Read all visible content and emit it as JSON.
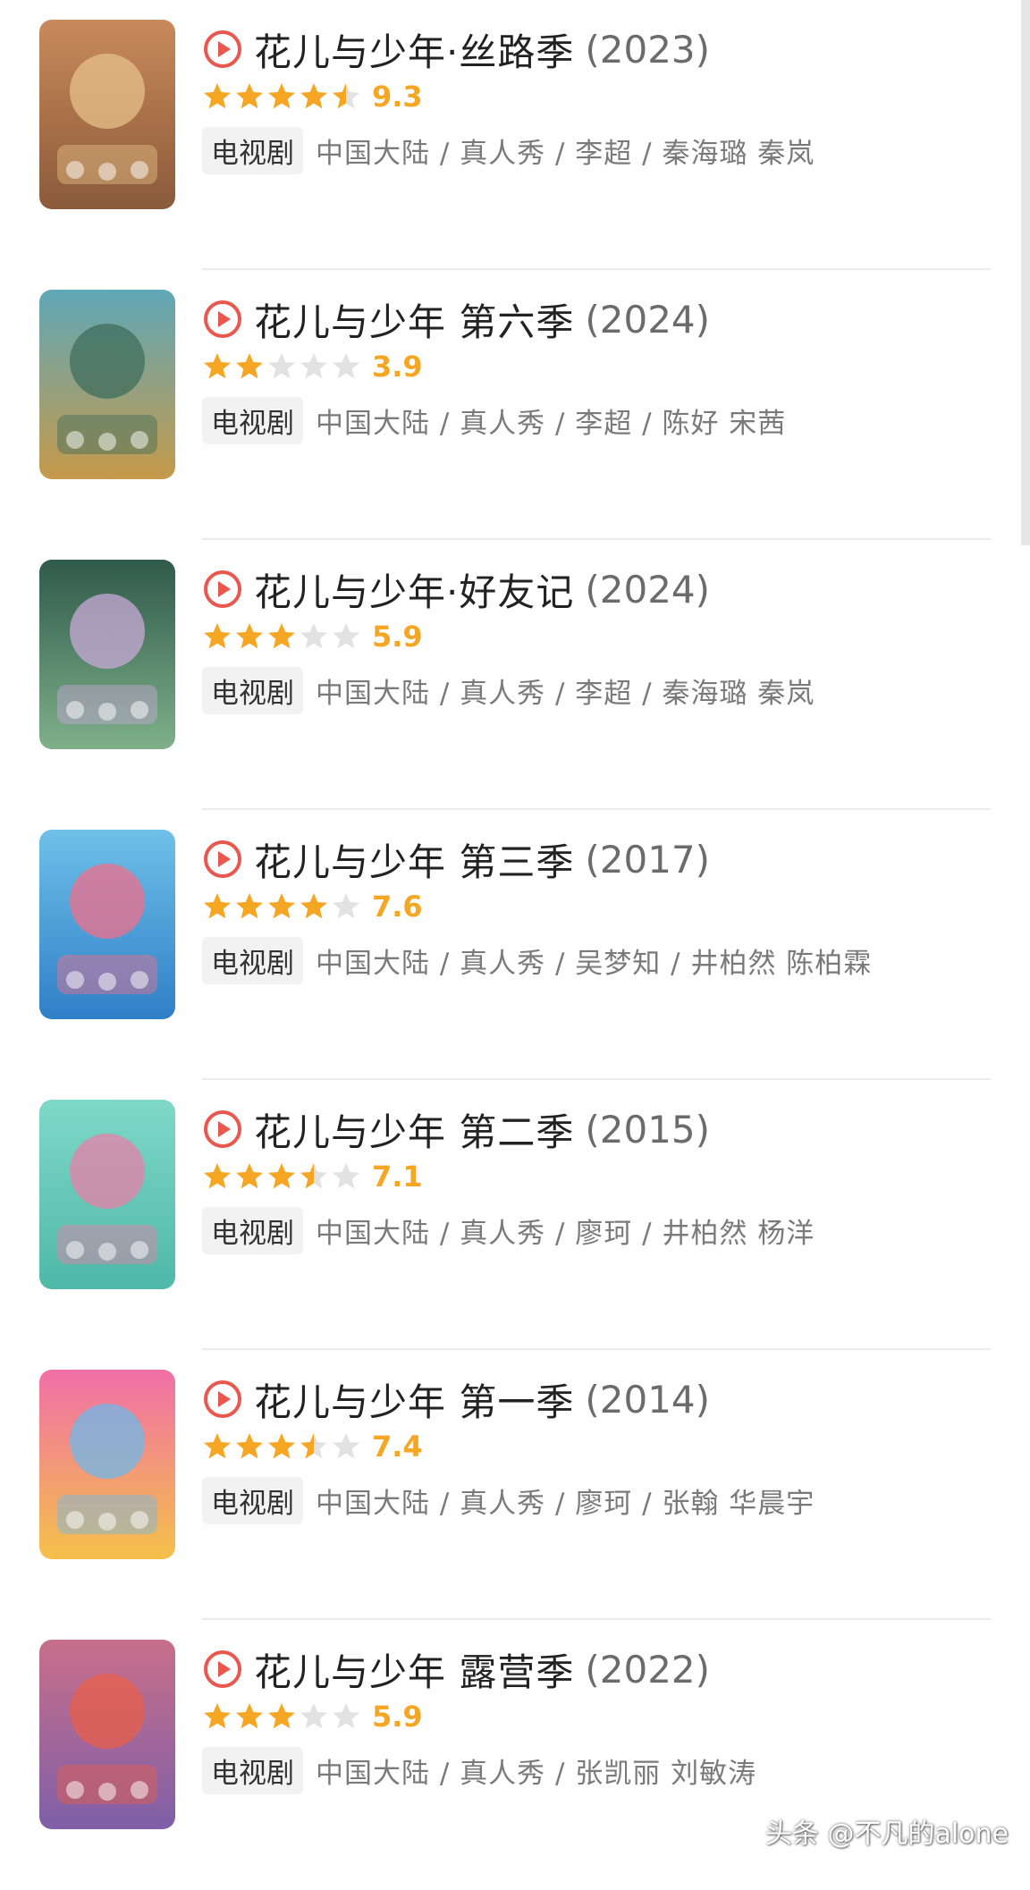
{
  "items": [
    {
      "title": "花儿与少年·丝路季",
      "year": "(2023)",
      "score": "9.3",
      "rating": 4.5,
      "tag": "电视剧",
      "meta": "中国大陆 / 真人秀 / 李超 / 秦海璐 秦岚"
    },
    {
      "title": "花儿与少年 第六季",
      "year": "(2024)",
      "score": "3.9",
      "rating": 2,
      "tag": "电视剧",
      "meta": "中国大陆 / 真人秀 / 李超 / 陈好 宋茜"
    },
    {
      "title": "花儿与少年·好友记",
      "year": "(2024)",
      "score": "5.9",
      "rating": 3,
      "tag": "电视剧",
      "meta": "中国大陆 / 真人秀 / 李超 / 秦海璐 秦岚"
    },
    {
      "title": "花儿与少年 第三季",
      "year": "(2017)",
      "score": "7.6",
      "rating": 4,
      "tag": "电视剧",
      "meta": "中国大陆 / 真人秀 / 吴梦知 / 井柏然 陈柏霖"
    },
    {
      "title": "花儿与少年 第二季",
      "year": "(2015)",
      "score": "7.1",
      "rating": 3.5,
      "tag": "电视剧",
      "meta": "中国大陆 / 真人秀 / 廖珂 / 井柏然 杨洋"
    },
    {
      "title": "花儿与少年 第一季",
      "year": "(2014)",
      "score": "7.4",
      "rating": 3.5,
      "tag": "电视剧",
      "meta": "中国大陆 / 真人秀 / 廖珂 / 张翰 华晨宇"
    },
    {
      "title": "花儿与少年 露营季",
      "year": "(2022)",
      "score": "5.9",
      "rating": 3,
      "tag": "电视剧",
      "meta": "中国大陆 / 真人秀 / 张凯丽 刘敏涛"
    }
  ],
  "colors": {
    "star_filled": "#f5a623",
    "star_empty": "#e2e2e2",
    "play_icon": "#e8584f",
    "posters": [
      [
        "#c98a5a",
        "#8a5a3a",
        "#e7c08a"
      ],
      [
        "#5fa7b8",
        "#c69a4a",
        "#3f6d5c"
      ],
      [
        "#2f5a4a",
        "#7fb08a",
        "#c8a9d8"
      ],
      [
        "#6fc0e8",
        "#2f7fc8",
        "#f06f8a"
      ],
      [
        "#7fd8c8",
        "#4fb8a8",
        "#e87fa8"
      ],
      [
        "#f06fa8",
        "#f5c04a",
        "#6fb8e8"
      ],
      [
        "#c86f8a",
        "#7f5fa8",
        "#e85f4a"
      ]
    ]
  },
  "icons": {
    "play": "play-circle-icon",
    "star": "star-icon"
  },
  "watermark": "头条 @不凡的alone"
}
